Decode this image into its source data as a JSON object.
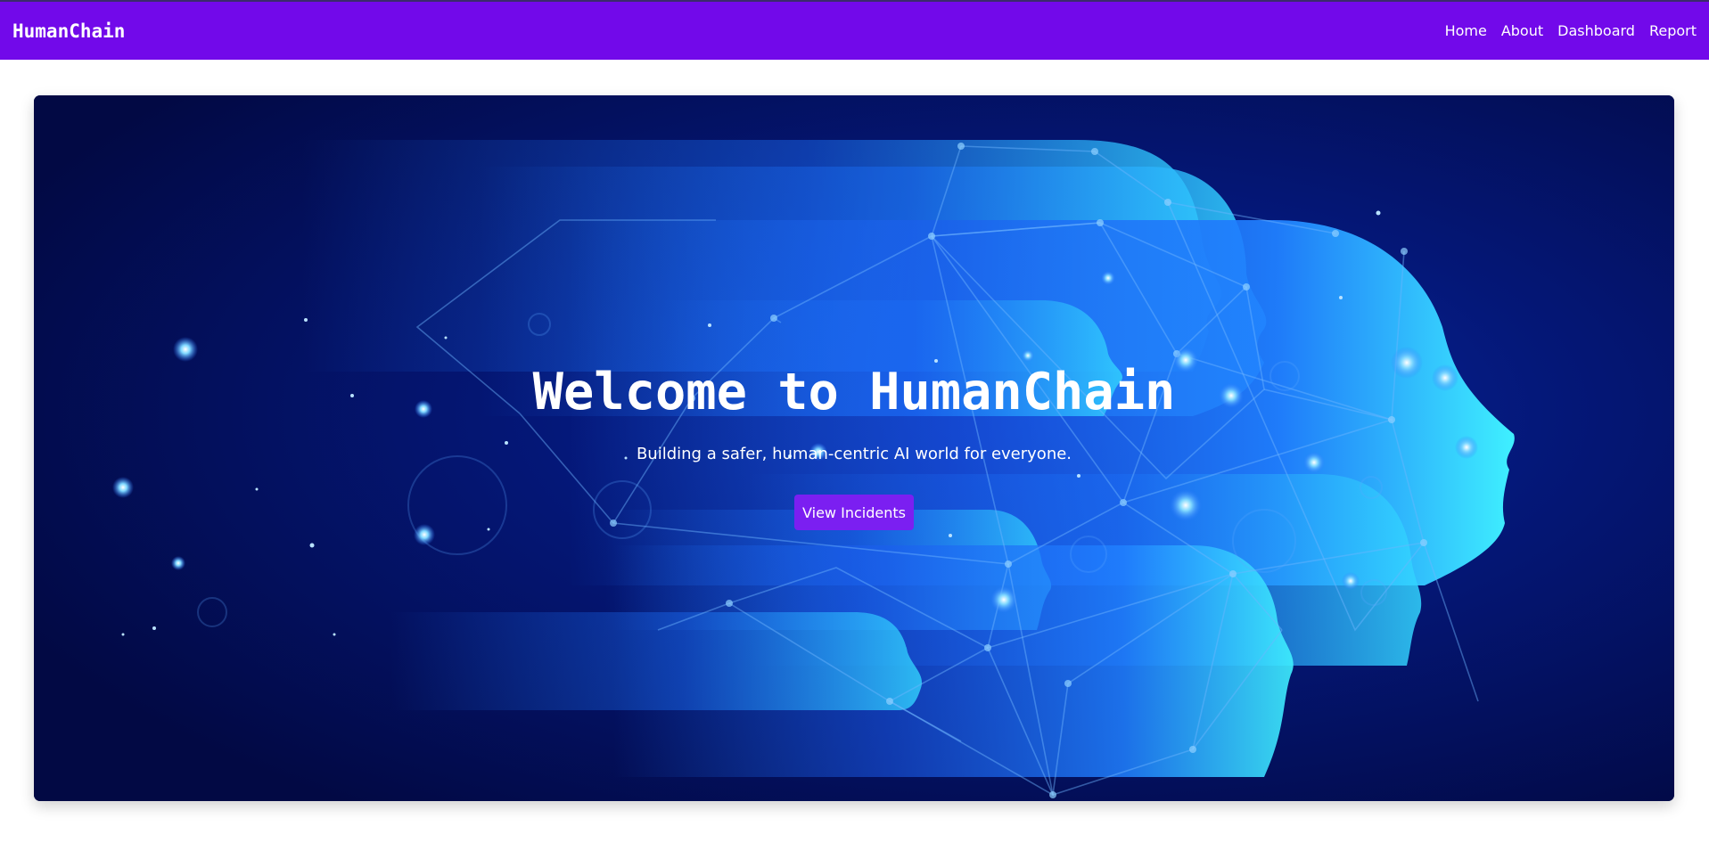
{
  "navbar": {
    "brand": "HumanChain",
    "links": [
      "Home",
      "About",
      "Dashboard",
      "Report"
    ]
  },
  "hero": {
    "title": "Welcome to HumanChain",
    "subtitle": "Building a safer, human-centric AI world for everyone.",
    "button_label": "View Incidents",
    "image_icon": "ai-heads-network-illustration"
  },
  "colors": {
    "navbar": "#7209ea",
    "button": "#7b1ff1",
    "hero_background": "#020b4a",
    "head_glow": "#1f7bff",
    "head_highlight": "#3fe7ff"
  }
}
